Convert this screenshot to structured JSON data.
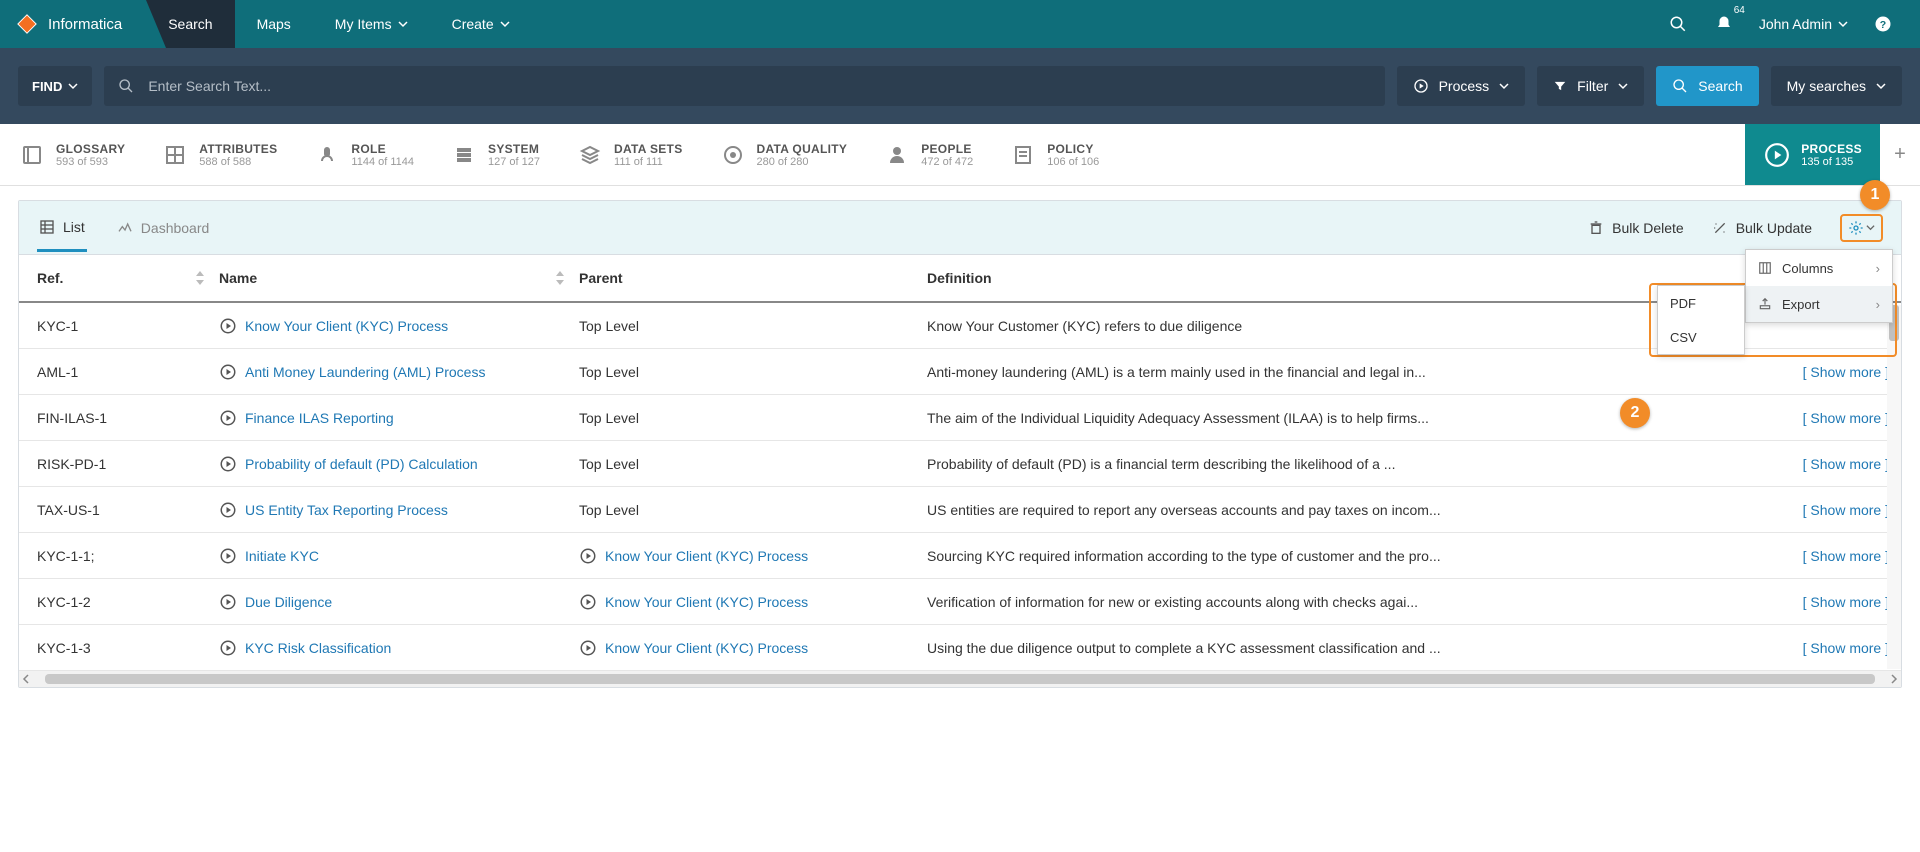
{
  "brand": "Informatica",
  "nav": {
    "tabs": [
      "Search",
      "Maps",
      "My Items",
      "Create"
    ],
    "active": "Search",
    "badge": "64",
    "user": "John Admin"
  },
  "searchbar": {
    "find": "FIND",
    "placeholder": "Enter Search Text...",
    "process": "Process",
    "filter": "Filter",
    "search": "Search",
    "mysearches": "My searches"
  },
  "categories": [
    {
      "title": "GLOSSARY",
      "count": "593 of 593"
    },
    {
      "title": "ATTRIBUTES",
      "count": "588 of 588"
    },
    {
      "title": "ROLE",
      "count": "1144 of 1144"
    },
    {
      "title": "SYSTEM",
      "count": "127 of 127"
    },
    {
      "title": "DATA SETS",
      "count": "111 of 111"
    },
    {
      "title": "DATA QUALITY",
      "count": "280 of 280"
    },
    {
      "title": "PEOPLE",
      "count": "472 of 472"
    },
    {
      "title": "POLICY",
      "count": "106 of 106"
    },
    {
      "title": "PROCESS",
      "count": "135 of 135"
    }
  ],
  "panel": {
    "list": "List",
    "dashboard": "Dashboard",
    "bulkDelete": "Bulk Delete",
    "bulkUpdate": "Bulk Update"
  },
  "gearMenu": {
    "columns": "Columns",
    "export": "Export",
    "pdf": "PDF",
    "csv": "CSV"
  },
  "callouts": {
    "one": "1",
    "two": "2"
  },
  "columns": {
    "ref": "Ref.",
    "name": "Name",
    "parent": "Parent",
    "definition": "Definition"
  },
  "showMore": "[ Show more ]",
  "rows": [
    {
      "ref": "KYC-1",
      "name": "Know Your Client (KYC) Process",
      "parent": "Top Level",
      "parentLink": false,
      "def": "Know Your Customer (KYC) refers to due diligence",
      "showMore": false
    },
    {
      "ref": "AML-1",
      "name": "Anti Money Laundering (AML) Process",
      "parent": "Top Level",
      "parentLink": false,
      "def": "Anti-money laundering (AML) is a term mainly used in the financial and legal in...",
      "showMore": true
    },
    {
      "ref": "FIN-ILAS-1",
      "name": "Finance ILAS Reporting",
      "parent": "Top Level",
      "parentLink": false,
      "def": "The aim of the Individual Liquidity Adequacy Assessment (ILAA) is to help firms...",
      "showMore": true
    },
    {
      "ref": "RISK-PD-1",
      "name": "Probability of default (PD) Calculation",
      "parent": "Top Level",
      "parentLink": false,
      "def": "Probability of default (PD) is a financial term describing the likelihood of a ...",
      "showMore": true
    },
    {
      "ref": "TAX-US-1",
      "name": "US Entity Tax Reporting Process",
      "parent": "Top Level",
      "parentLink": false,
      "def": "US entities are required to report any overseas accounts and pay taxes on incom...",
      "showMore": true
    },
    {
      "ref": "KYC-1-1;",
      "name": "Initiate KYC",
      "parent": "Know Your Client (KYC) Process",
      "parentLink": true,
      "def": "Sourcing KYC required information according to the type of customer and the pro...",
      "showMore": true
    },
    {
      "ref": "KYC-1-2",
      "name": "Due Diligence",
      "parent": "Know Your Client (KYC) Process",
      "parentLink": true,
      "def": "Verification of information for new or existing accounts along with checks agai...",
      "showMore": true
    },
    {
      "ref": "KYC-1-3",
      "name": "KYC Risk Classification",
      "parent": "Know Your Client (KYC) Process",
      "parentLink": true,
      "def": "Using the due diligence output to complete a KYC assessment classification and ...",
      "showMore": true
    }
  ]
}
